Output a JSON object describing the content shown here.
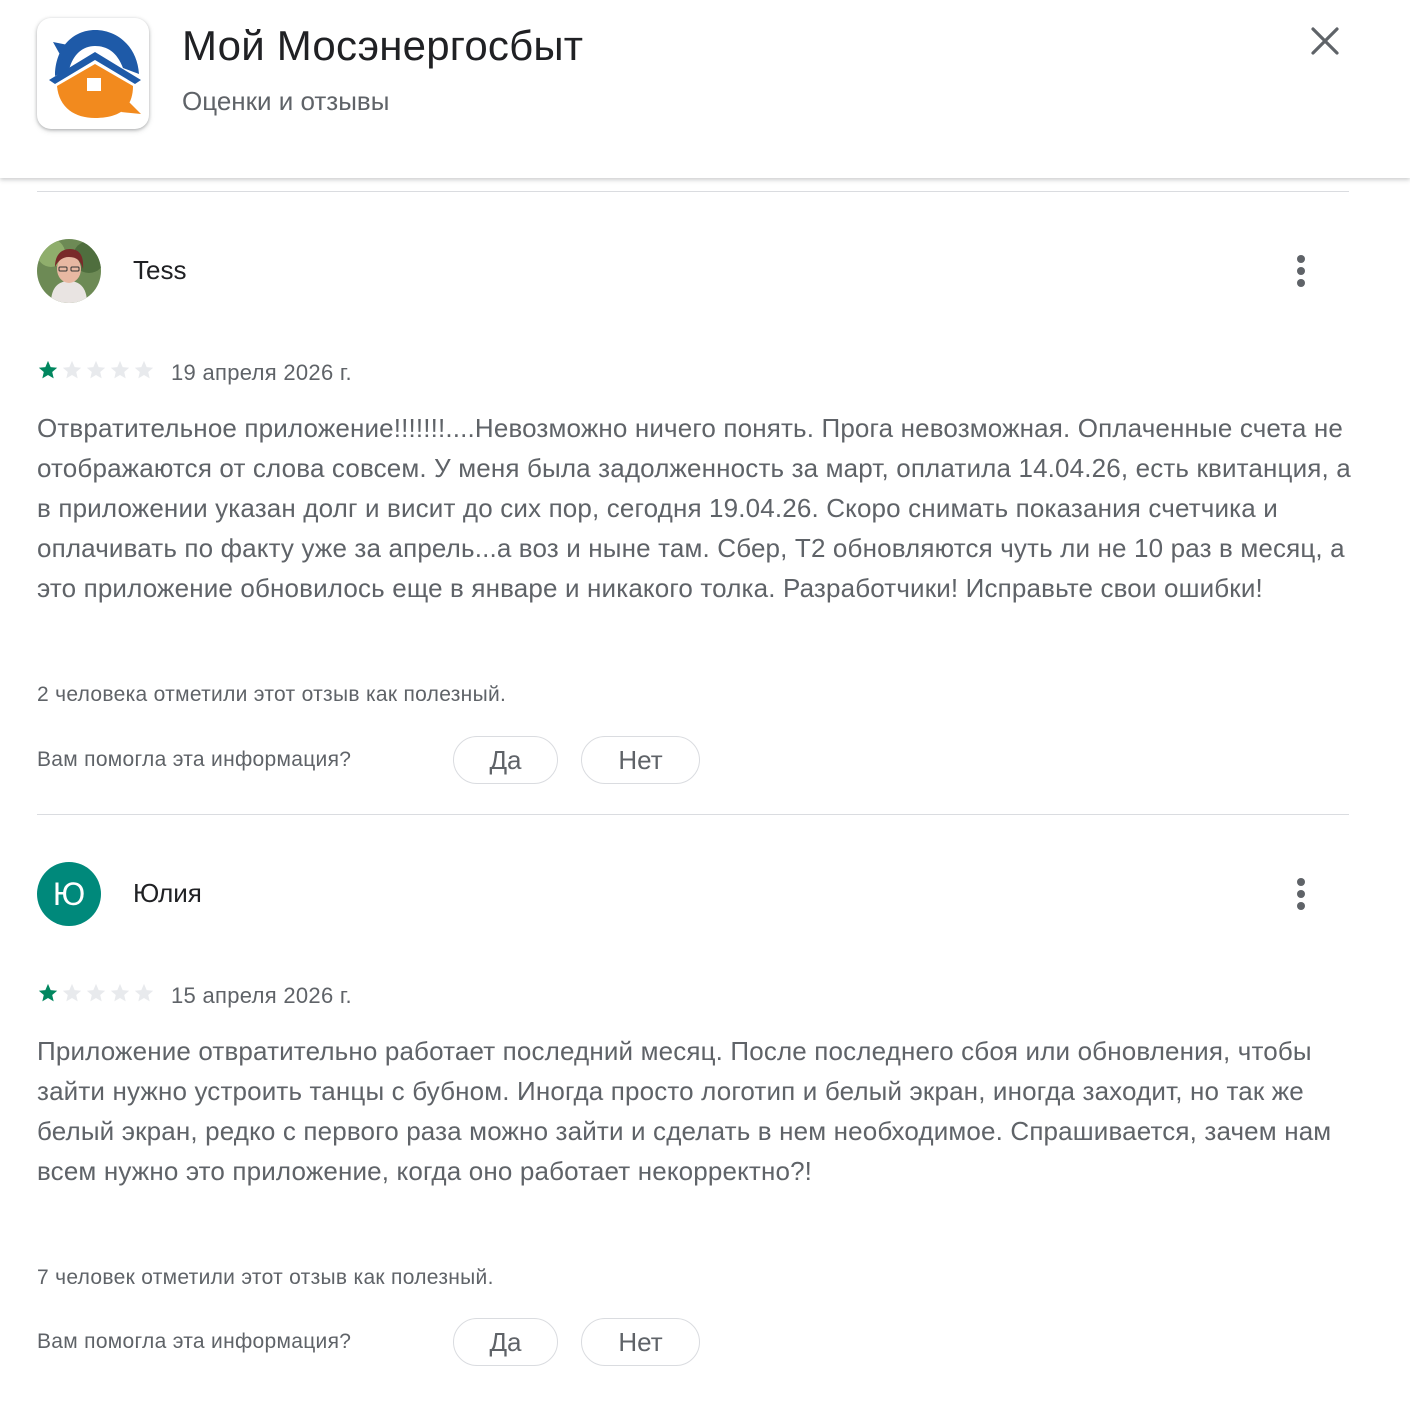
{
  "header": {
    "app_title": "Мой Мосэнергосбыт",
    "subtitle": "Оценки и отзывы",
    "icons": {
      "app_logo": "house-logo",
      "close": "close-icon"
    },
    "colors": {
      "logo_blue": "#1e5aa8",
      "logo_orange": "#f28a1e"
    }
  },
  "reviews": [
    {
      "author": "Tess",
      "avatar": "photo",
      "rating": 1,
      "max_rating": 5,
      "date": "19 апреля 2026 г.",
      "text": "Отвратительное приложение!!!!!!!....Невозможно ничего понять. Прога невозможная. Оплаченные счета не отображаются от слова совсем. У меня была задолженность за март, оплатила 14.04.26, есть квитанция, а в приложении указан долг и висит до сих пор, сегодня 19.04.26. Скоро снимать показания счетчика и оплачивать по факту уже за апрель...а воз и ныне там. Сбер, Т2 обновляются чуть ли не 10 раз в месяц, а это приложение обновилось еще в январе и никакого толка. Разработчики! Исправьте свои ошибки!",
      "helpful_count_text": "2 человека отметили этот отзыв как полезный.",
      "helpful_question": "Вам помогла эта информация?",
      "yes_label": "Да",
      "no_label": "Нет"
    },
    {
      "author": "Юлия",
      "avatar_letter": "Ю",
      "avatar_color": "#00897b",
      "rating": 1,
      "max_rating": 5,
      "date": "15 апреля 2026 г.",
      "text": "Приложение отвратительно работает последний месяц. После последнего сбоя или обновления, чтобы зайти нужно устроить танцы с бубном. Иногда просто логотип и белый экран, иногда заходит, но так же белый экран, редко с первого раза можно зайти и сделать в нем необходимое. Спрашивается, зачем нам всем нужно это приложение, когда оно работает некорректно?!",
      "helpful_count_text": "7 человек отметили этот отзыв как полезный.",
      "helpful_question": "Вам помогла эта информация?",
      "yes_label": "Да",
      "no_label": "Нет"
    }
  ],
  "star_colors": {
    "filled": "#01875f",
    "empty": "#e8eaed"
  }
}
